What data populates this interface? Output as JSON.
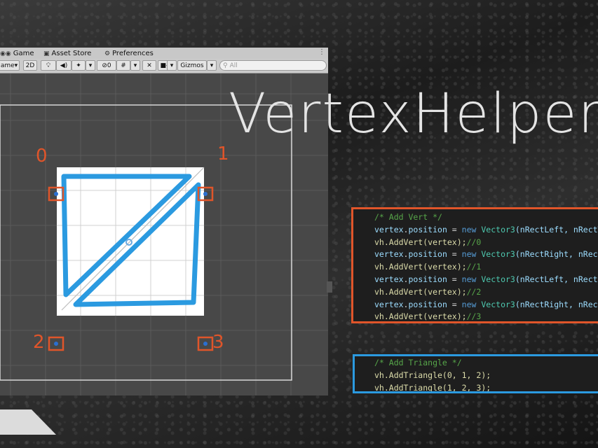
{
  "title": "VertexHelper",
  "window": {
    "tabs": [
      {
        "label": "Game",
        "icon": "gamepad-icon"
      },
      {
        "label": "Asset Store",
        "icon": "shopping-bag-icon"
      },
      {
        "label": "Preferences",
        "icon": "gear-icon"
      }
    ],
    "toolbar": {
      "display_dropdown": "ame",
      "mode_2d": "2D",
      "hidden_count": "0",
      "gizmos": "Gizmos",
      "search_placeholder": "All"
    }
  },
  "vertex_labels": [
    "0",
    "1",
    "2",
    "3"
  ],
  "code_vert": {
    "comment": "/* Add Vert */",
    "lines": [
      {
        "kind": "pos",
        "var": "vertex",
        "prop": "position",
        "kw": "new",
        "type": "Vector3",
        "args": "(nRectLeft, nRectTop"
      },
      {
        "kind": "add",
        "call": "vh.AddVert(vertex);",
        "comment": "//0"
      },
      {
        "kind": "pos",
        "var": "vertex",
        "prop": "position",
        "kw": "new",
        "type": "Vector3",
        "args": "(nRectRight, nRectTop"
      },
      {
        "kind": "add",
        "call": "vh.AddVert(vertex);",
        "comment": "//1"
      },
      {
        "kind": "pos",
        "var": "vertex",
        "prop": "position",
        "kw": "new",
        "type": "Vector3",
        "args": "(nRectLeft, nRectBottom"
      },
      {
        "kind": "add",
        "call": "vh.AddVert(vertex);",
        "comment": "//2"
      },
      {
        "kind": "pos",
        "var": "vertex",
        "prop": "position",
        "kw": "new",
        "type": "Vector3",
        "args": "(nRectRight, nRectBottom"
      },
      {
        "kind": "add",
        "call": "vh.AddVert(vertex);",
        "comment": "//3"
      }
    ]
  },
  "code_tri": {
    "comment": "/* Add Triangle */",
    "lines": [
      "vh.AddTriangle(0, 1, 2);",
      "vh.AddTriangle(1, 2, 3);"
    ]
  },
  "colors": {
    "orange": "#e0552a",
    "blue": "#2b9ae0",
    "title": "#e4e4e4"
  }
}
